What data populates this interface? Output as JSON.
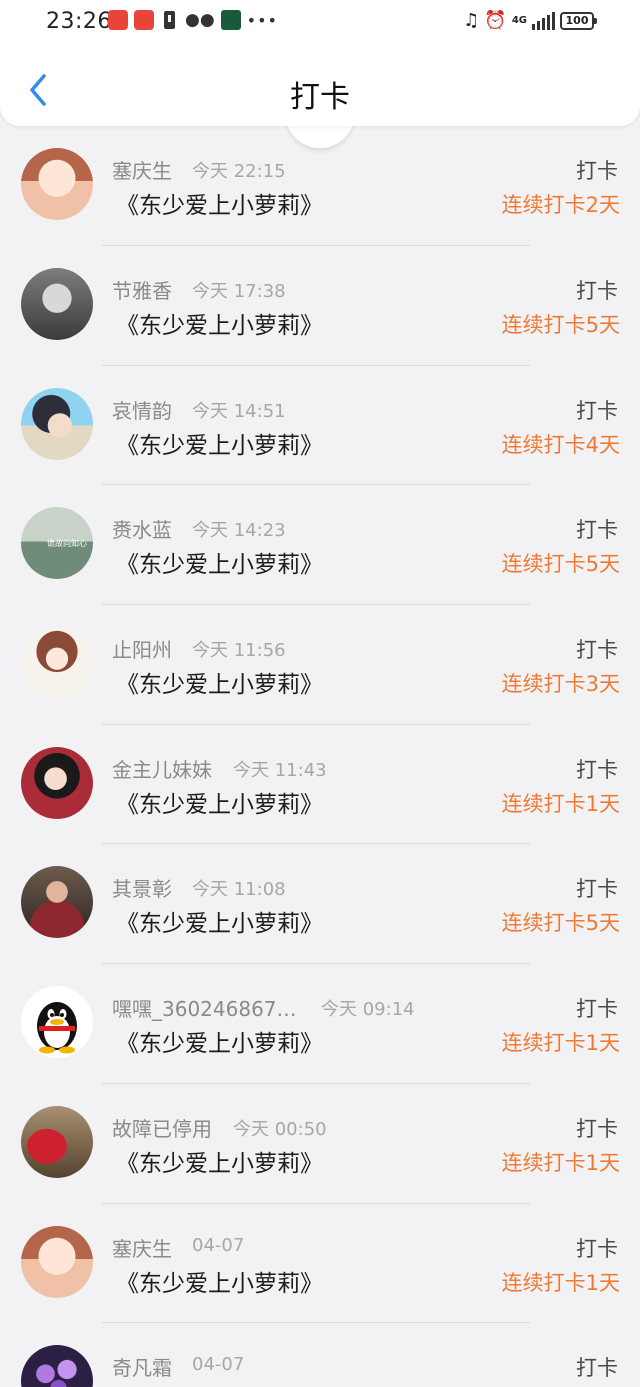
{
  "status_bar": {
    "time": "23:26",
    "left_icons": [
      "app-badge-icon",
      "app-badge-icon",
      "sim-card-icon",
      "wechat-icon",
      "app-icon",
      "more-icon"
    ],
    "right_icons": [
      "headphones-icon",
      "alarm-icon",
      "4g-signal-icon",
      "battery-icon"
    ],
    "network": "4G",
    "battery": "100"
  },
  "nav": {
    "title": "打卡",
    "back_icon": "back-chevron-icon"
  },
  "colors": {
    "accent": "#2f8fe8",
    "streak": "#f07a33",
    "name": "#8a8a8a",
    "time": "#a7a7a7"
  },
  "checkins": [
    {
      "name": "塞庆生",
      "time": "今天 22:15",
      "title": "《东少爱上小萝莉》",
      "tag": "打卡",
      "streak": "连续打卡2天"
    },
    {
      "name": "节雅香",
      "time": "今天 17:38",
      "title": "《东少爱上小萝莉》",
      "tag": "打卡",
      "streak": "连续打卡5天"
    },
    {
      "name": "哀情韵",
      "time": "今天 14:51",
      "title": "《东少爱上小萝莉》",
      "tag": "打卡",
      "streak": "连续打卡4天"
    },
    {
      "name": "赉水蓝",
      "time": "今天 14:23",
      "title": "《东少爱上小萝莉》",
      "tag": "打卡",
      "streak": "连续打卡5天",
      "avatar_caption": "诡故向知心"
    },
    {
      "name": "止阳州",
      "time": "今天 11:56",
      "title": "《东少爱上小萝莉》",
      "tag": "打卡",
      "streak": "连续打卡3天"
    },
    {
      "name": "金主儿妹妹",
      "time": "今天 11:43",
      "title": "《东少爱上小萝莉》",
      "tag": "打卡",
      "streak": "连续打卡1天"
    },
    {
      "name": "其景彰",
      "time": "今天 11:08",
      "title": "《东少爱上小萝莉》",
      "tag": "打卡",
      "streak": "连续打卡5天"
    },
    {
      "name": "嘿嘿_360246867…",
      "time": "今天 09:14",
      "title": "《东少爱上小萝莉》",
      "tag": "打卡",
      "streak": "连续打卡1天"
    },
    {
      "name": "故障已停用",
      "time": "今天 00:50",
      "title": "《东少爱上小萝莉》",
      "tag": "打卡",
      "streak": "连续打卡1天"
    },
    {
      "name": "塞庆生",
      "time": "04-07",
      "title": "《东少爱上小萝莉》",
      "tag": "打卡",
      "streak": "连续打卡1天"
    },
    {
      "name": "奇凡霜",
      "time": "04-07",
      "tag": "打卡"
    }
  ]
}
